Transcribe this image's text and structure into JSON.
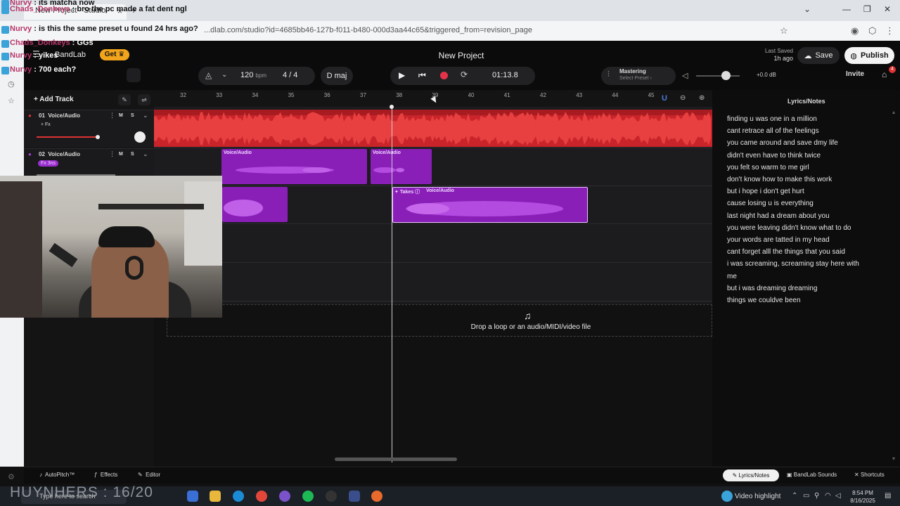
{
  "browser": {
    "tab_title": "New Project - Studio",
    "url": "...dlab.com/studio?id=4685bb46-127b-f011-b480-000d3aa44c65&triggered_from=revision_page"
  },
  "chat": [
    {
      "user": "Nurvy",
      "msg": ": its matcha now"
    },
    {
      "user": "Chads_Donkeys",
      "msg": ": bro the pc made a fat dent ngl"
    },
    {
      "user": "Nurvy",
      "msg": ": is this the same preset u found 24 hrs ago?"
    },
    {
      "user": "Chads_Donkeys",
      "msg": ": GGs"
    },
    {
      "user": "Nurvy",
      "msg": ": yikes"
    },
    {
      "user": "Nurvy",
      "msg": ": 700 each?"
    }
  ],
  "header": {
    "logo": "BandLab",
    "get_label": "Get",
    "project_title": "New Project",
    "last_saved_label": "Last Saved",
    "last_saved_value": "1h ago",
    "save_label": "Save",
    "publish_label": "Publish",
    "invite_label": "Invite",
    "gift_badge": "4"
  },
  "transport": {
    "bpm": "120",
    "bpm_unit": "bpm",
    "time_signature": "4 / 4",
    "key": "D maj",
    "time": "01:13.8",
    "mastering_title": "Mastering",
    "mastering_preset": "Select Preset",
    "volume_db": "+0.0 dB"
  },
  "toolbar": {
    "add_track_label": "+ Add Track"
  },
  "ruler": [
    "32",
    "33",
    "34",
    "35",
    "36",
    "37",
    "38",
    "39",
    "40",
    "41",
    "42",
    "43",
    "44",
    "45"
  ],
  "tracks": [
    {
      "number": "01",
      "name": "Voice/Audio",
      "fx": "+ Fx",
      "mute": "M",
      "solo": "S"
    },
    {
      "number": "02",
      "name": "Voice/Audio",
      "fx": "Fx 3ns",
      "mute": "M",
      "solo": "S"
    }
  ],
  "clips": {
    "a_label": "Voice/Audio",
    "b_label": "Voice/Audio",
    "takes_label": "Takes",
    "takes_clip_label": "Voice/Audio"
  },
  "dropzone": {
    "text": "Drop a loop or an audio/MIDI/video file"
  },
  "lyrics": {
    "title": "Lyrics/Notes",
    "lines": [
      "finding u was one in a million",
      "cant retrace all of the feelings",
      "you came around and save dmy life",
      "didn't even have to think twice",
      "you felt so warm to me girl",
      "don't know how to make this work",
      "but i hope i don't get hurt",
      "cause losing u is everything",
      "last night had a dream about you",
      "you were leaving didn't know what to do",
      "your words are tatted in my head",
      "cant forget alll the things that you said",
      "i was screaming, screaming stay here with",
      "me",
      "but i was dreaming dreaming",
      "things we couldve been"
    ]
  },
  "bottom": {
    "autopitch": "AutoPitch™",
    "effects": "Effects",
    "editor": "Editor",
    "lyrics_tab": "Lyrics/Notes",
    "sounds_tab": "BandLab Sounds",
    "shortcuts": "Shortcuts"
  },
  "taskbar": {
    "search_placeholder": "Type here to search",
    "overlay_name": "HUYNHERS : 16/20",
    "video_highlight": "Video highlight",
    "time": "8:54 PM",
    "date": "8/16/2025"
  },
  "colors": {
    "track1": "#c8242a",
    "track2": "#8a1fb8",
    "record": "#e4324a",
    "get_button": "#f2a51c"
  }
}
